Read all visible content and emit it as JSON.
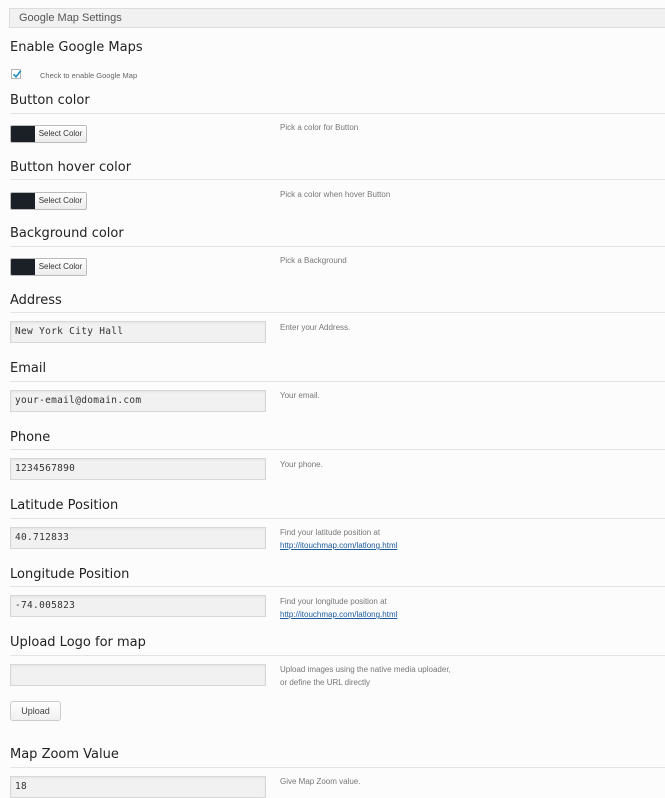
{
  "header": {
    "title": "Google Map Settings"
  },
  "enable": {
    "title": "Enable Google Maps",
    "checkbox_label": "Check to enable Google Map",
    "checked": true
  },
  "button_color": {
    "title": "Button color",
    "button_label": "Select Color",
    "swatch": "#1b1f26",
    "desc": "Pick a color for Button"
  },
  "button_hover_color": {
    "title": "Button hover color",
    "button_label": "Select Color",
    "swatch": "#1b1f26",
    "desc": "Pick a color when hover Button"
  },
  "background_color": {
    "title": "Background color",
    "button_label": "Select Color",
    "swatch": "#1b1f26",
    "desc": "Pick a Background"
  },
  "address": {
    "title": "Address",
    "value": "New York City Hall",
    "desc": "Enter your Address."
  },
  "email": {
    "title": "Email",
    "value": "your-email@domain.com",
    "desc": "Your email."
  },
  "phone": {
    "title": "Phone",
    "value": "1234567890",
    "desc": "Your phone."
  },
  "latitude": {
    "title": "Latitude Position",
    "value": "40.712833",
    "desc": "Find your latitude position at",
    "link": "http://itouchmap.com/latlong.html"
  },
  "longitude": {
    "title": "Longitude Position",
    "value": "-74.005823",
    "desc": "Find your longitude position at",
    "link": "http://itouchmap.com/latlong.html"
  },
  "upload_logo": {
    "title": "Upload Logo for map",
    "value": "",
    "desc_line1": "Upload images using the native media uploader,",
    "desc_line2": "or define the URL directly",
    "button_label": "Upload"
  },
  "zoom": {
    "title": "Map Zoom Value",
    "value": "18",
    "desc": "Give Map Zoom value."
  }
}
